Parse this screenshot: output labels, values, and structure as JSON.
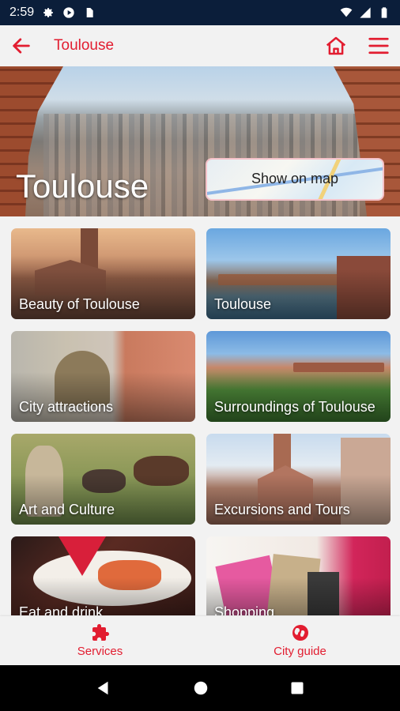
{
  "status_bar": {
    "time": "2:59",
    "left_icons": [
      "gear-icon",
      "play-store-icon",
      "sim-card-icon"
    ],
    "right_icons": [
      "wifi-icon",
      "signal-icon",
      "battery-icon"
    ]
  },
  "app_bar": {
    "title": "Toulouse",
    "back_icon": "arrow-left-icon",
    "actions": [
      "home-icon",
      "menu-icon"
    ]
  },
  "hero": {
    "title": "Toulouse",
    "map_button_label": "Show on map"
  },
  "cards": [
    {
      "label": "Beauty of Toulouse"
    },
    {
      "label": "Toulouse"
    },
    {
      "label": "City attractions"
    },
    {
      "label": "Surroundings of Toulouse"
    },
    {
      "label": "Art and Culture"
    },
    {
      "label": "Excursions and Tours"
    },
    {
      "label": "Eat and drink"
    },
    {
      "label": "Shopping"
    }
  ],
  "bottom_nav": {
    "items": [
      {
        "label": "Services",
        "icon": "puzzle-icon"
      },
      {
        "label": "City guide",
        "icon": "globe-icon"
      }
    ]
  },
  "colors": {
    "accent": "#e21d30",
    "status_bar": "#0b1e3a",
    "background": "#f2f2f2"
  }
}
